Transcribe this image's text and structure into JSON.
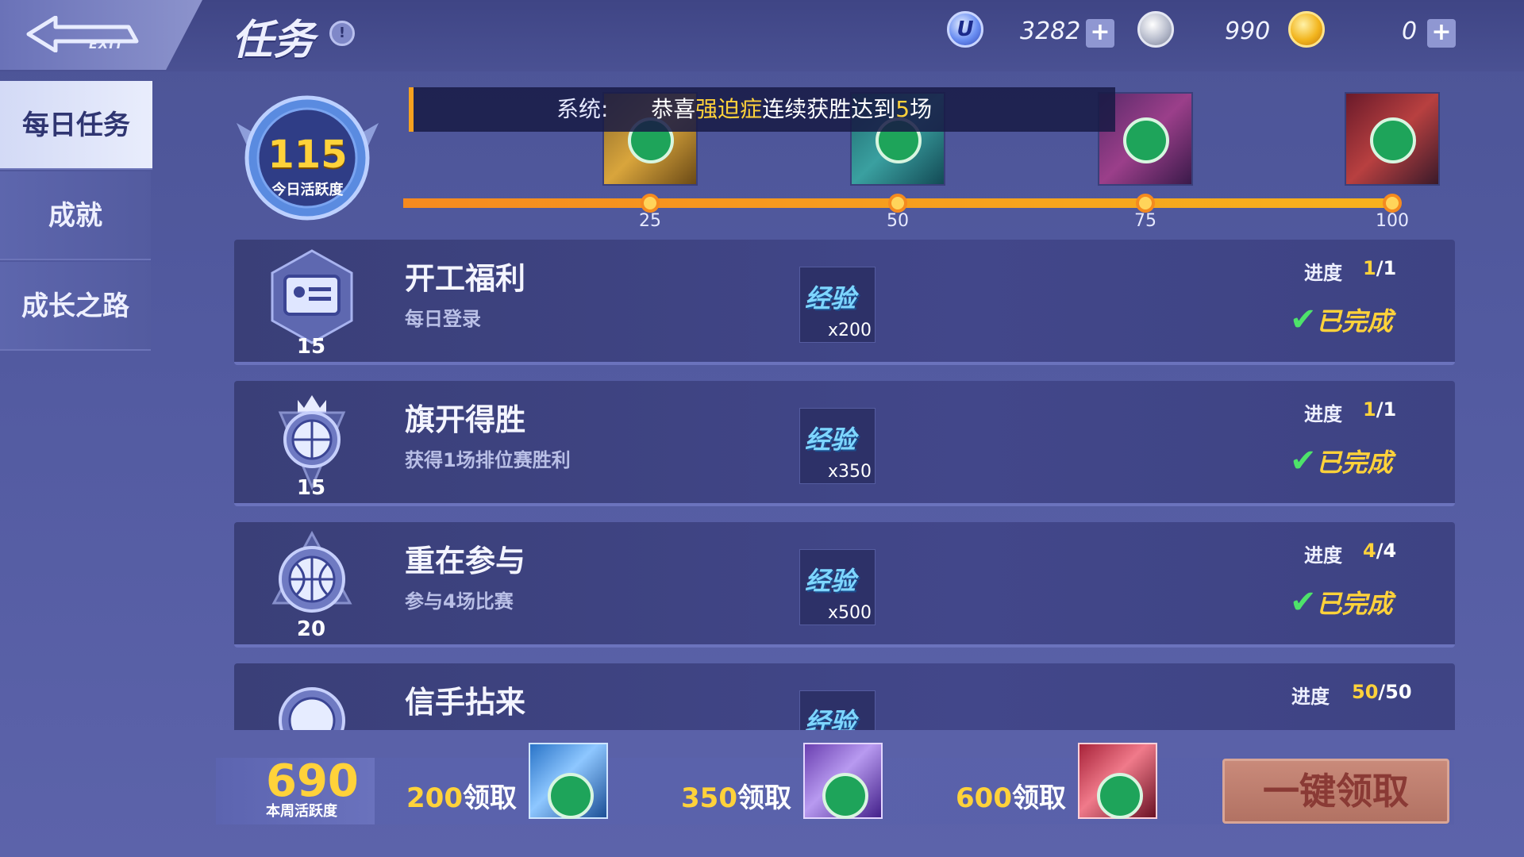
{
  "header": {
    "exit_label": "EXIT",
    "title": "任务",
    "currencies": [
      {
        "icon": "u-coin-icon",
        "value": "3282",
        "has_plus": true
      },
      {
        "icon": "silver-basketball-icon",
        "value": "990",
        "has_plus": false
      },
      {
        "icon": "gold-basketball-icon",
        "value": "0",
        "has_plus": true
      }
    ]
  },
  "nav": {
    "items": [
      {
        "label": "每日任务",
        "active": true
      },
      {
        "label": "成就",
        "active": false
      },
      {
        "label": "成长之路",
        "active": false
      }
    ]
  },
  "daily_activity": {
    "value": "115",
    "label": "今日活跃度"
  },
  "system_message": {
    "prefix": "系统:",
    "part1": "恭喜",
    "player": "强迫症",
    "part2": "连续获胜达到",
    "count": "5",
    "part3": "场"
  },
  "milestones": [
    {
      "label": "25",
      "claimed": true
    },
    {
      "label": "50",
      "claimed": true
    },
    {
      "label": "75",
      "claimed": true
    },
    {
      "label": "100",
      "claimed": true
    }
  ],
  "tasks": [
    {
      "name": "开工福利",
      "desc": "每日登录",
      "points": "15",
      "icon": "id-card-icon",
      "reward_text": "经验",
      "reward_qty": "x200",
      "progress_label": "进度",
      "progress_cur": "1",
      "progress_total": "/1",
      "status": "已完成"
    },
    {
      "name": "旗开得胜",
      "desc": "获得1场排位赛胜利",
      "points": "15",
      "icon": "crowned-basketball-icon",
      "reward_text": "经验",
      "reward_qty": "x350",
      "progress_label": "进度",
      "progress_cur": "1",
      "progress_total": "/1",
      "status": "已完成"
    },
    {
      "name": "重在参与",
      "desc": "参与4场比赛",
      "points": "20",
      "icon": "basketball-badge-icon",
      "reward_text": "经验",
      "reward_qty": "x500",
      "progress_label": "进度",
      "progress_cur": "4",
      "progress_total": "/4",
      "status": "已完成"
    },
    {
      "name": "信手拈来",
      "desc": "",
      "points": "",
      "icon": "basketball-badge-icon",
      "reward_text": "经验",
      "reward_qty": "",
      "progress_label": "进度",
      "progress_cur": "50",
      "progress_total": "/50",
      "status": ""
    }
  ],
  "weekly": {
    "value": "690",
    "label": "本周活跃度",
    "claims": [
      {
        "threshold": "200",
        "suffix": "领取"
      },
      {
        "threshold": "350",
        "suffix": "领取"
      },
      {
        "threshold": "600",
        "suffix": "领取"
      }
    ],
    "claim_all_label": "一键领取"
  },
  "colors": {
    "accent_gold": "#ffd23a",
    "bar_orange": "#f58a1f",
    "check_green": "#1ea45a"
  }
}
